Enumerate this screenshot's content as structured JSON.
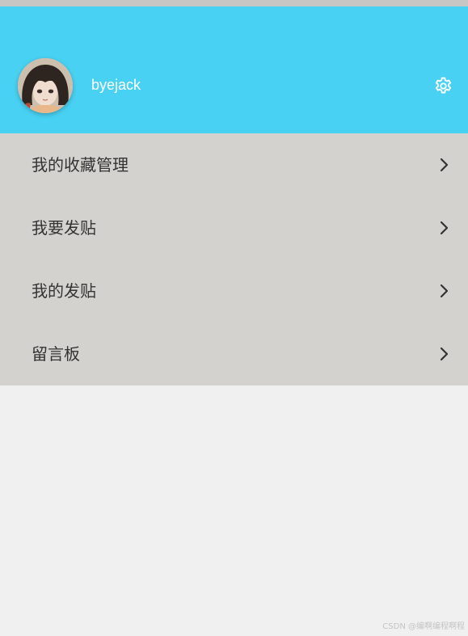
{
  "header": {
    "username": "byejack",
    "avatar_icon": "user-avatar-photo",
    "settings_icon": "gear-icon",
    "background_color": "#49d1f3"
  },
  "menu": {
    "background_color": "#d4d2cf",
    "items": [
      {
        "label": "我的收藏管理",
        "icon": "chevron-right-icon"
      },
      {
        "label": "我要发贴",
        "icon": "chevron-right-icon"
      },
      {
        "label": "我的发贴",
        "icon": "chevron-right-icon"
      },
      {
        "label": "留言板",
        "icon": "chevron-right-icon"
      }
    ]
  },
  "watermark": "CSDN @编啊编程啊程"
}
